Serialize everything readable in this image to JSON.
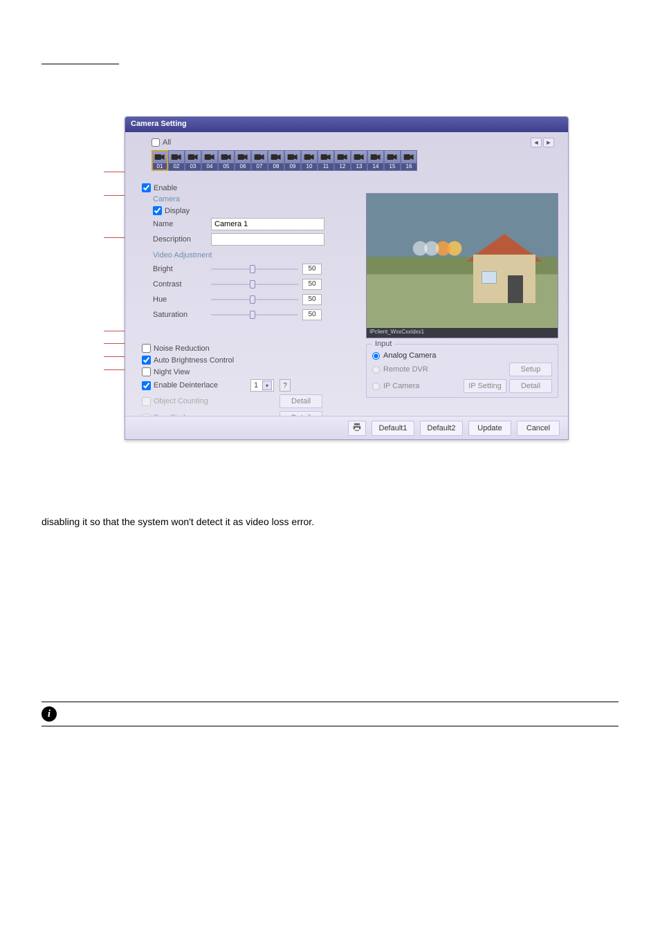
{
  "dialog": {
    "title": "Camera Setting",
    "all_label": "All",
    "all_checked": false,
    "arrow_left": "◄",
    "arrow_right": "►"
  },
  "camera_tabs": [
    "01",
    "02",
    "03",
    "04",
    "05",
    "06",
    "07",
    "08",
    "09",
    "10",
    "11",
    "12",
    "13",
    "14",
    "15",
    "16"
  ],
  "camera_tab_selected": 0,
  "enable": {
    "label": "Enable",
    "checked": true
  },
  "camera_group": {
    "label": "Camera",
    "display": {
      "label": "Display",
      "checked": true
    },
    "name": {
      "label": "Name",
      "value": "Camera 1"
    },
    "description": {
      "label": "Description",
      "value": ""
    }
  },
  "video_adjustment": {
    "label": "Video Adjustment",
    "bright": {
      "label": "Bright",
      "value": "50"
    },
    "contrast": {
      "label": "Contrast",
      "value": "50"
    },
    "hue": {
      "label": "Hue",
      "value": "50"
    },
    "saturation": {
      "label": "Saturation",
      "value": "50"
    }
  },
  "options": {
    "noise_reduction": {
      "label": "Noise Reduction",
      "checked": false
    },
    "auto_brightness": {
      "label": "Auto Brightness Control",
      "checked": true
    },
    "night_view": {
      "label": "Night View",
      "checked": false
    },
    "enable_deinterlace": {
      "label": "Enable Deinterlace",
      "checked": true,
      "select_value": "1",
      "help_glyph": "?"
    },
    "object_counting": {
      "label": "Object Counting",
      "checked": false,
      "detail_label": "Detail"
    },
    "facefinder": {
      "label": "FaceFinder",
      "checked": false,
      "detail_label": "Detail"
    }
  },
  "preview": {
    "caption": "IPclient_WxxCxxIdxx1"
  },
  "input_group": {
    "legend": "Input",
    "analog": {
      "label": "Analog Camera",
      "selected": true
    },
    "remote_dvr": {
      "label": "Remote DVR",
      "selected": false,
      "setup_label": "Setup"
    },
    "ip_camera": {
      "label": "IP Camera",
      "selected": false,
      "ip_setting_label": "IP Setting",
      "detail_label": "Detail"
    }
  },
  "footer": {
    "default1": "Default1",
    "default2": "Default2",
    "update": "Update",
    "cancel": "Cancel"
  },
  "below_text": "disabling it so that the system won't detect it as video loss error.",
  "info_icon_glyph": "i"
}
